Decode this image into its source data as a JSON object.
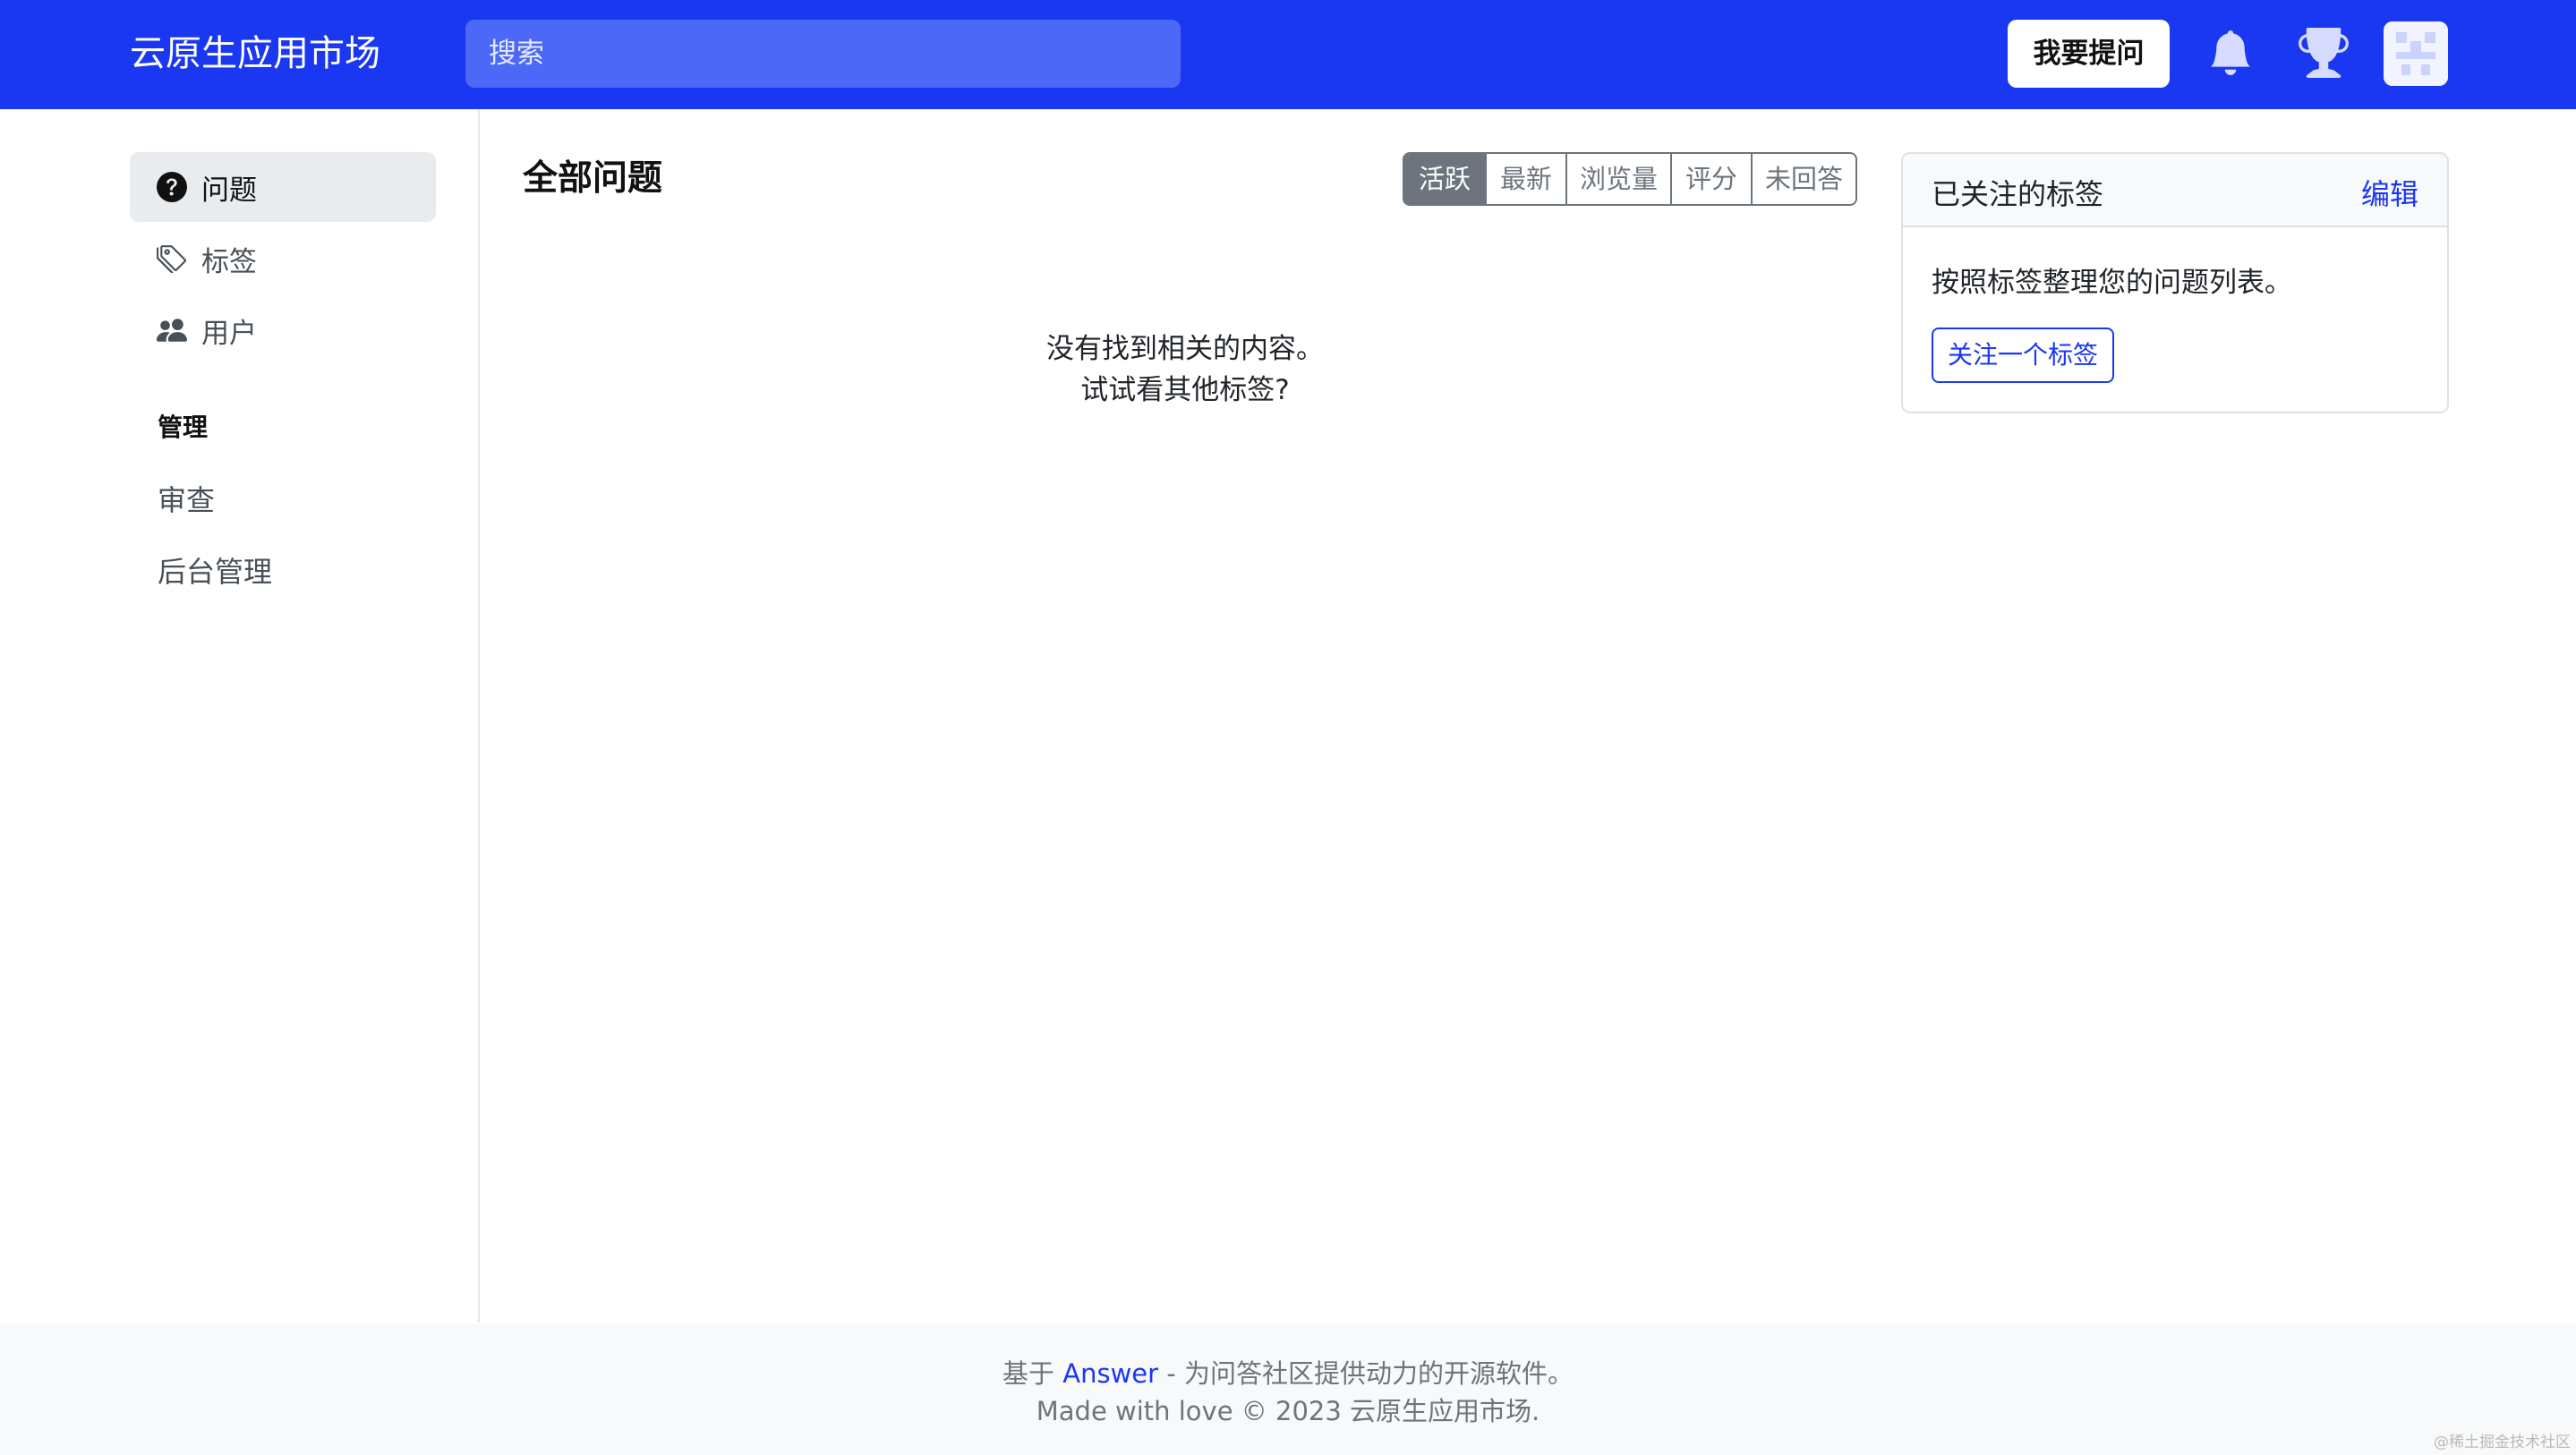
{
  "header": {
    "brand": "云原生应用市场",
    "search_placeholder": "搜索",
    "ask_button": "我要提问",
    "icons": [
      "bell-icon",
      "trophy-icon",
      "avatar"
    ]
  },
  "sidebar": {
    "items": [
      {
        "label": "问题",
        "icon": "question-circle-icon",
        "active": true
      },
      {
        "label": "标签",
        "icon": "tags-icon",
        "active": false
      },
      {
        "label": "用户",
        "icon": "people-icon",
        "active": false
      }
    ],
    "admin_heading": "管理",
    "admin_links": [
      "审查",
      "后台管理"
    ]
  },
  "main": {
    "title": "全部问题",
    "sort_tabs": [
      "活跃",
      "最新",
      "浏览量",
      "评分",
      "未回答"
    ],
    "active_sort": "活跃",
    "empty_line1": "没有找到相关的内容。",
    "empty_line2": "试试看其他标签?"
  },
  "followed_tags": {
    "title": "已关注的标签",
    "edit_label": "编辑",
    "description": "按照标签整理您的问题列表。",
    "follow_button": "关注一个标签"
  },
  "footer": {
    "prefix": "基于 ",
    "link": "Answer",
    "suffix": " - 为问答社区提供动力的开源软件。",
    "line2": "Made with love © 2023 云原生应用市场."
  },
  "watermark": "@稀土掘金技术社区",
  "colors": {
    "primary": "#1a37f2",
    "search_bg": "#4c68f7",
    "active_sort_bg": "#6c757d",
    "sidebar_active_bg": "#e9ecef"
  }
}
